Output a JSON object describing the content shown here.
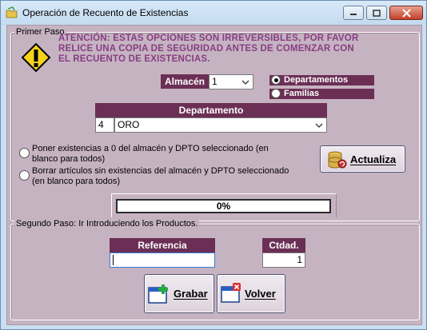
{
  "window": {
    "title": "Operación de Recuento de Existencias"
  },
  "step1": {
    "legend": "Primer Paso",
    "warning": "ATENCIÓN:  ESTAS OPCIONES SON IRREVERSIBLES, POR FAVOR RELICE UNA COPIA DE SEGURIDAD ANTES DE COMENZAR CON EL RECUENTO DE EXISTENCIAS.",
    "almacen_label": "Almacén",
    "almacen_value": "1",
    "radio_departamentos": "Departamentos",
    "radio_familias": "Familias",
    "departamento_label": "Departamento",
    "departamento_code": "4",
    "departamento_name": "ORO",
    "option_zero": "Poner existencias a 0 del almacén y DPTO seleccionado (en blanco para todos)",
    "option_delete": "Borrar artículos sin existencias del almacén y DPTO seleccionado (en blanco para todos)",
    "actualiza_label": "Actualiza",
    "progress_text": "0%",
    "progress_value": 0
  },
  "step2": {
    "legend": "Segundo Paso: Ir Introduciendo los Productos.",
    "referencia_label": "Referencia",
    "referencia_value": "",
    "ctdad_label": "Ctdad.",
    "ctdad_value": "1",
    "grabar_label": "Grabar",
    "volver_label": "Volver"
  },
  "colors": {
    "accent": "#6b2f55",
    "warning_text": "#863e83",
    "panel": "#c6b3c1"
  }
}
